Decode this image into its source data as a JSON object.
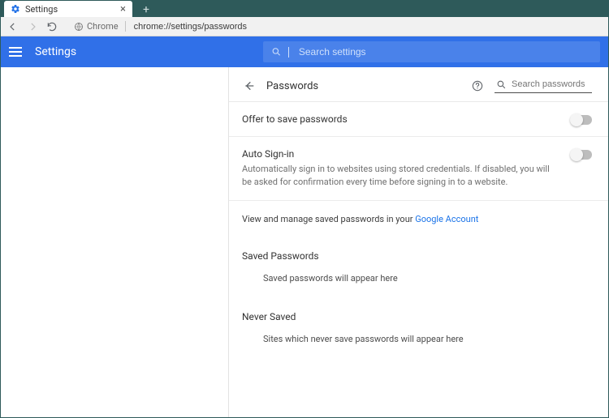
{
  "browser": {
    "tab_title": "Settings",
    "url_source": "Chrome",
    "url": "chrome://settings/passwords"
  },
  "header": {
    "app_title": "Settings",
    "search_placeholder": "Search settings"
  },
  "content": {
    "page_title": "Passwords",
    "pw_search_placeholder": "Search passwords",
    "offer_save_label": "Offer to save passwords",
    "auto_signin": {
      "label": "Auto Sign-in",
      "description": "Automatically sign in to websites using stored credentials. If disabled, you will be asked for confirmation every time before signing in to a website."
    },
    "manage_text_prefix": "View and manage saved passwords in your ",
    "manage_link": "Google Account",
    "saved_heading": "Saved Passwords",
    "saved_empty": "Saved passwords will appear here",
    "never_heading": "Never Saved",
    "never_empty": "Sites which never save passwords will appear here"
  }
}
